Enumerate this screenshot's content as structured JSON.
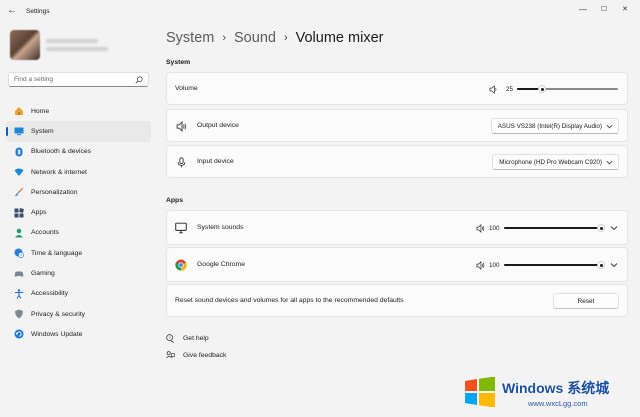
{
  "window": {
    "title": "Settings",
    "back_glyph": "←",
    "minimize_glyph": "—",
    "maximize_glyph": "☐",
    "close_glyph": "✕"
  },
  "search": {
    "placeholder": "Find a setting",
    "icon": "search-icon"
  },
  "sidebar": {
    "items": [
      {
        "label": "Home",
        "icon": "home-icon",
        "active": false
      },
      {
        "label": "System",
        "icon": "system-display-icon",
        "active": true
      },
      {
        "label": "Bluetooth & devices",
        "icon": "bluetooth-icon",
        "active": false
      },
      {
        "label": "Network & internet",
        "icon": "wifi-icon",
        "active": false
      },
      {
        "label": "Personalization",
        "icon": "brush-icon",
        "active": false
      },
      {
        "label": "Apps",
        "icon": "apps-icon",
        "active": false
      },
      {
        "label": "Accounts",
        "icon": "account-icon",
        "active": false
      },
      {
        "label": "Time & language",
        "icon": "globe-clock-icon",
        "active": false
      },
      {
        "label": "Gaming",
        "icon": "gamepad-icon",
        "active": false
      },
      {
        "label": "Accessibility",
        "icon": "accessibility-icon",
        "active": false
      },
      {
        "label": "Privacy & security",
        "icon": "shield-icon",
        "active": false
      },
      {
        "label": "Windows Update",
        "icon": "update-icon",
        "active": false
      }
    ]
  },
  "breadcrumb": {
    "items": [
      "System",
      "Sound"
    ],
    "current": "Volume mixer",
    "separator": "›"
  },
  "system_section": {
    "heading": "System",
    "volume": {
      "label": "Volume",
      "value": "25",
      "level": 0.25
    },
    "output": {
      "label": "Output device",
      "selected": "ASUS VS238 (Intel(R) Display Audio)"
    },
    "input": {
      "label": "Input device",
      "selected": "Microphone (HD Pro Webcam C920)"
    }
  },
  "apps_section": {
    "heading": "Apps",
    "apps": [
      {
        "label": "System sounds",
        "icon": "monitor-icon",
        "value": "100",
        "level": 1.0
      },
      {
        "label": "Google Chrome",
        "icon": "chrome-icon",
        "value": "100",
        "level": 1.0
      }
    ],
    "reset": {
      "label": "Reset sound devices and volumes for all apps to the recommended defaults",
      "button": "Reset"
    }
  },
  "links": {
    "help": "Get help",
    "feedback": "Give feedback"
  },
  "watermark": {
    "brand": "Windows 系统城",
    "url": "www.wxcLgg.com"
  },
  "colors": {
    "accent": "#005fb8",
    "background": "#f3f3f3",
    "card": "#fbfbfb"
  }
}
